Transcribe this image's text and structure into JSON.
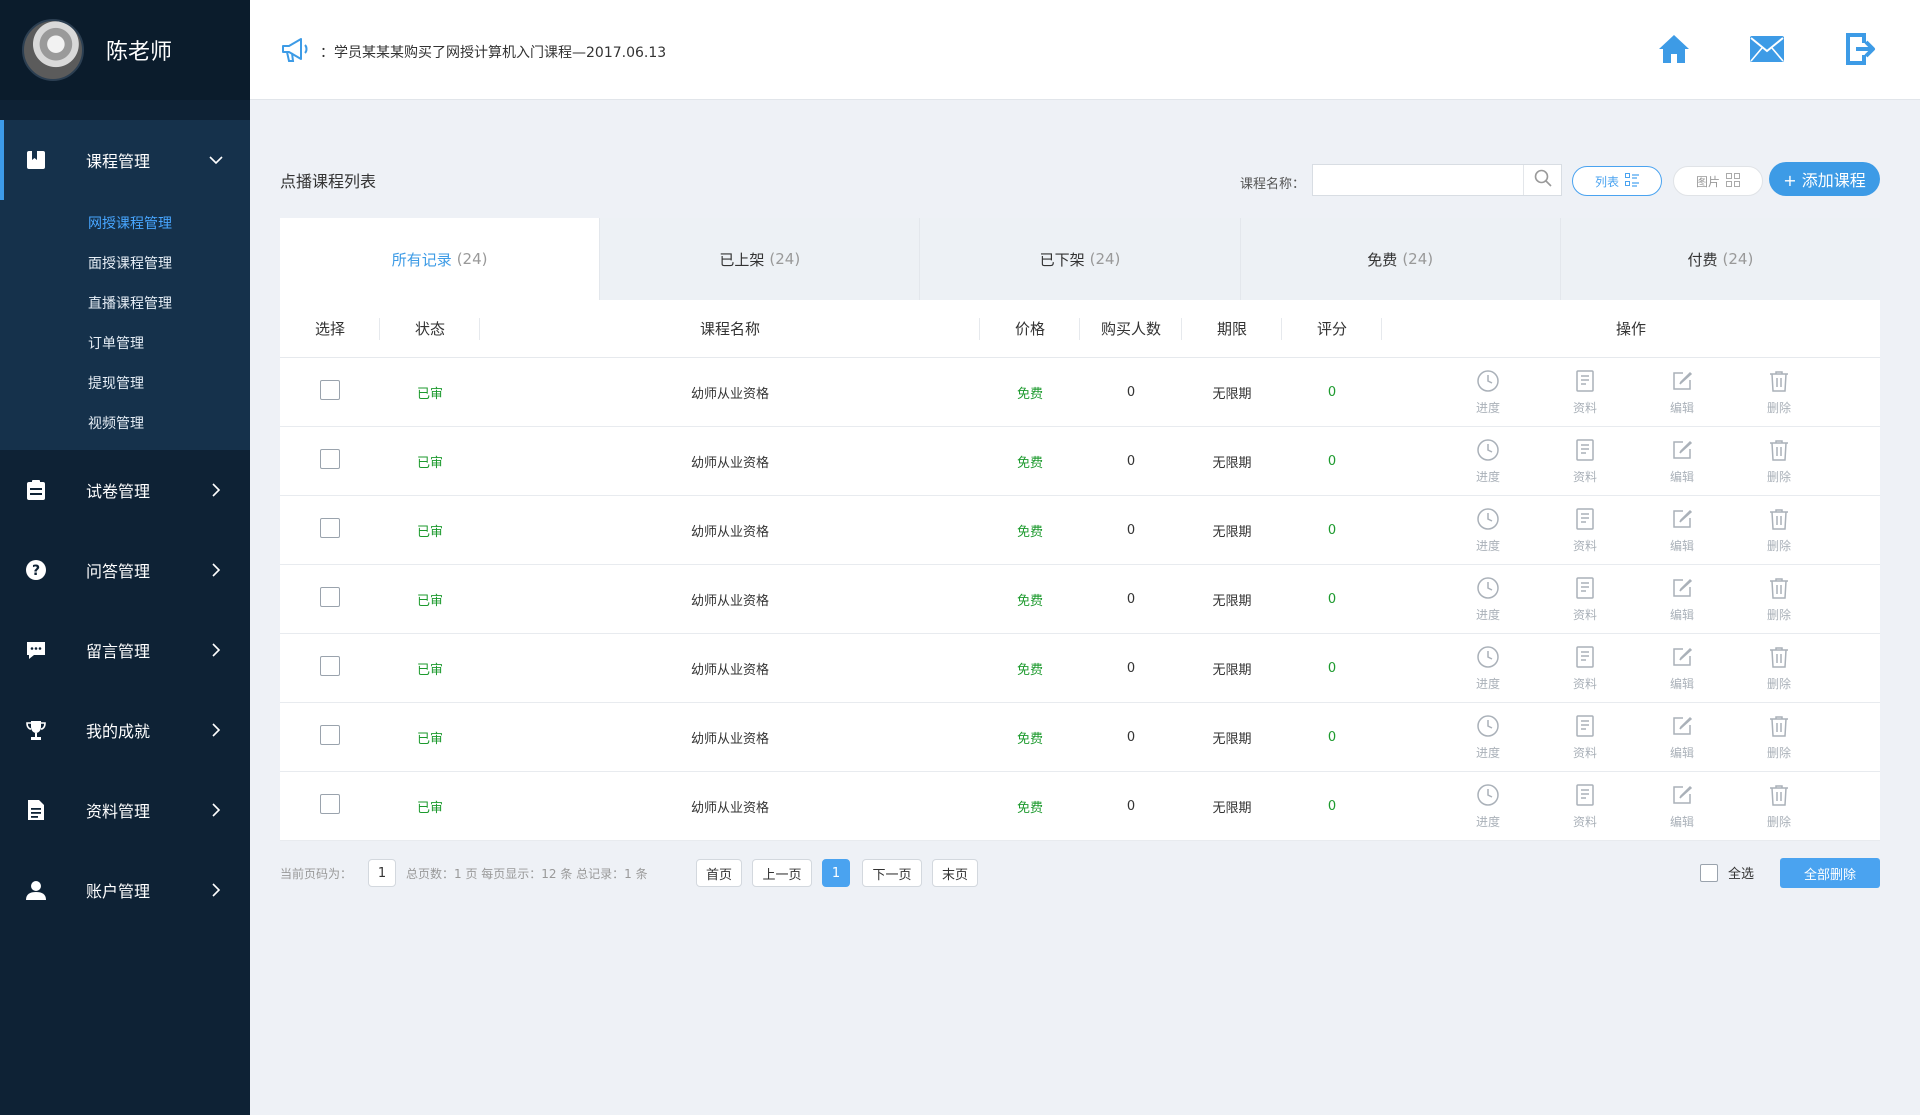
{
  "user": {
    "name": "陈老师"
  },
  "notice": {
    "text": "：学员某某某购买了网授计算机入门课程—2017.06.13"
  },
  "sidebar": {
    "items": [
      {
        "label": "课程管理",
        "icon": "book-icon",
        "expanded": true
      },
      {
        "label": "试卷管理",
        "icon": "clipboard-icon"
      },
      {
        "label": "问答管理",
        "icon": "question-icon"
      },
      {
        "label": "留言管理",
        "icon": "message-icon"
      },
      {
        "label": "我的成就",
        "icon": "trophy-icon"
      },
      {
        "label": "资料管理",
        "icon": "document-icon"
      },
      {
        "label": "账户管理",
        "icon": "user-icon"
      }
    ],
    "submenu": [
      {
        "label": "网授课程管理",
        "active": true
      },
      {
        "label": "面授课程管理"
      },
      {
        "label": "直播课程管理"
      },
      {
        "label": "订单管理"
      },
      {
        "label": "提现管理"
      },
      {
        "label": "视频管理"
      }
    ]
  },
  "page": {
    "title": "点播课程列表"
  },
  "search": {
    "label": "课程名称：",
    "value": "",
    "placeholder": ""
  },
  "view": {
    "list_label": "列表",
    "pic_label": "图片"
  },
  "add_button": "+ 添加课程",
  "tabs": [
    {
      "label": "所有记录",
      "count": "(24)",
      "active": true
    },
    {
      "label": "已上架",
      "count": "(24)"
    },
    {
      "label": "已下架",
      "count": "(24)"
    },
    {
      "label": "免费",
      "count": "(24)"
    },
    {
      "label": "付费",
      "count": "(24)"
    }
  ],
  "table": {
    "headers": [
      "选择",
      "状态",
      "课程名称",
      "价格",
      "购买人数",
      "期限",
      "评分",
      "操作"
    ],
    "rows": [
      {
        "status": "已审",
        "name": "幼师从业资格",
        "price": "免费",
        "buyers": "0",
        "term": "无限期",
        "score": "0"
      },
      {
        "status": "已审",
        "name": "幼师从业资格",
        "price": "免费",
        "buyers": "0",
        "term": "无限期",
        "score": "0"
      },
      {
        "status": "已审",
        "name": "幼师从业资格",
        "price": "免费",
        "buyers": "0",
        "term": "无限期",
        "score": "0"
      },
      {
        "status": "已审",
        "name": "幼师从业资格",
        "price": "免费",
        "buyers": "0",
        "term": "无限期",
        "score": "0"
      },
      {
        "status": "已审",
        "name": "幼师从业资格",
        "price": "免费",
        "buyers": "0",
        "term": "无限期",
        "score": "0"
      },
      {
        "status": "已审",
        "name": "幼师从业资格",
        "price": "免费",
        "buyers": "0",
        "term": "无限期",
        "score": "0"
      },
      {
        "status": "已审",
        "name": "幼师从业资格",
        "price": "免费",
        "buyers": "0",
        "term": "无限期",
        "score": "0"
      }
    ],
    "ops": [
      "进度",
      "资料",
      "编辑",
      "删除"
    ]
  },
  "pagination": {
    "current_label": "当前页码为：",
    "current": "1",
    "summary": "总页数：1 页  每页显示：12 条  总记录：1 条",
    "first": "首页",
    "prev": "上一页",
    "page": "1",
    "next": "下一页",
    "last": "末页"
  },
  "bulk": {
    "select_all": "全选",
    "delete_all": "全部删除"
  },
  "colors": {
    "sidebar_bg": "#0e2235",
    "accent": "#3d9be6",
    "status_green": "#1d9a2e"
  }
}
